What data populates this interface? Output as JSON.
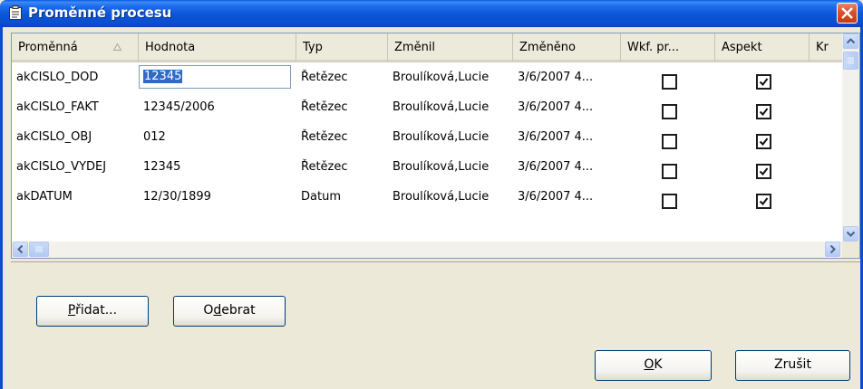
{
  "window": {
    "title": "Proměnné procesu",
    "icon": "clipboard-icon",
    "close_icon": "close-icon"
  },
  "grid": {
    "columns": [
      {
        "label": "Proměnná",
        "sort": "ascending"
      },
      {
        "label": "Hodnota"
      },
      {
        "label": "Typ"
      },
      {
        "label": "Změnil"
      },
      {
        "label": "Změněno"
      },
      {
        "label": "Wkf. pr..."
      },
      {
        "label": "Aspekt"
      },
      {
        "label": "Kr"
      }
    ],
    "rows": [
      {
        "var": "akCISLO_DOD",
        "value": "12345",
        "type": "Řetězec",
        "changed_by": "Broulíková,Lucie",
        "changed": "3/6/2007 4...",
        "wkf": false,
        "aspect": true
      },
      {
        "var": "akCISLO_FAKT",
        "value": "12345/2006",
        "type": "Řetězec",
        "changed_by": "Broulíková,Lucie",
        "changed": "3/6/2007 4...",
        "wkf": false,
        "aspect": true
      },
      {
        "var": "akCISLO_OBJ",
        "value": "012",
        "type": "Řetězec",
        "changed_by": "Broulíková,Lucie",
        "changed": "3/6/2007 4...",
        "wkf": false,
        "aspect": true
      },
      {
        "var": "akCISLO_VYDEJ",
        "value": "12345",
        "type": "Řetězec",
        "changed_by": "Broulíková,Lucie",
        "changed": "3/6/2007 4...",
        "wkf": false,
        "aspect": true
      },
      {
        "var": "akDATUM",
        "value": "12/30/1899",
        "type": "Datum",
        "changed_by": "Broulíková,Lucie",
        "changed": "3/6/2007 4...",
        "wkf": false,
        "aspect": true
      }
    ]
  },
  "buttons": {
    "add": {
      "pre": "",
      "mn": "P",
      "post": "řidat..."
    },
    "remove": {
      "pre": "O",
      "mn": "d",
      "post": "ebrat"
    },
    "ok": {
      "pre": "",
      "mn": "O",
      "post": "K"
    },
    "cancel": {
      "label": "Zrušit"
    }
  }
}
